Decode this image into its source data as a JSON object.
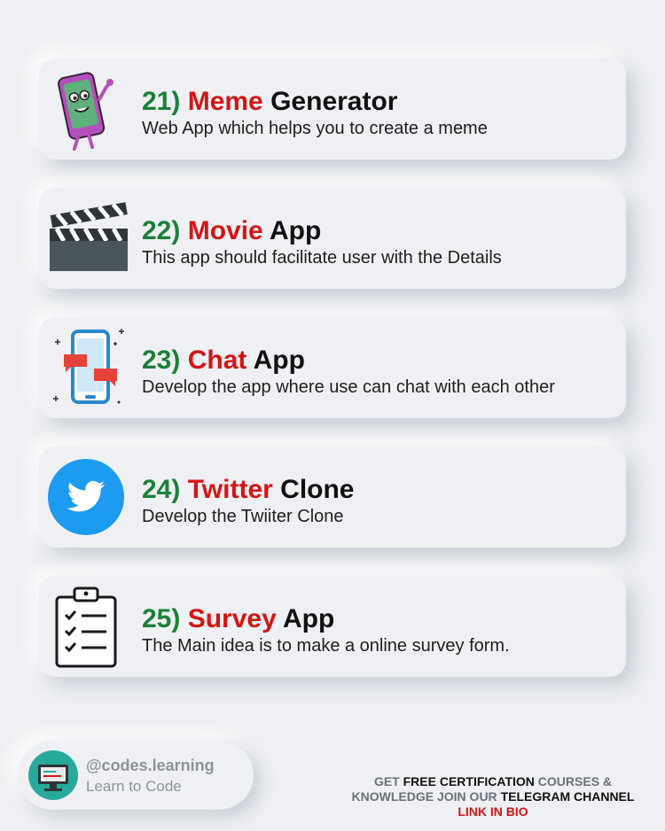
{
  "cards": [
    {
      "num": "21)",
      "highlight": "Meme",
      "rest": "Generator",
      "desc": "Web App which helps you to create a meme",
      "icon": "phone-character-icon"
    },
    {
      "num": "22)",
      "highlight": "Movie",
      "rest": "App",
      "desc": "This app should facilitate user with the Details",
      "icon": "clapperboard-icon"
    },
    {
      "num": "23)",
      "highlight": "Chat",
      "rest": "App",
      "desc": "Develop the app where use can chat with each other",
      "icon": "mobile-chat-icon"
    },
    {
      "num": "24)",
      "highlight": "Twitter",
      "rest": "Clone",
      "desc": "Develop the Twiiter Clone",
      "icon": "twitter-bird-icon"
    },
    {
      "num": "25)",
      "highlight": "Survey",
      "rest": "App",
      "desc": "The Main idea is to make a online survey form.",
      "icon": "clipboard-checklist-icon"
    }
  ],
  "profile": {
    "handle": "@codes.learning",
    "tagline": "Learn to Code",
    "avatar_icon": "computer-avatar-icon"
  },
  "promo": {
    "p1": "GET ",
    "p2": "FREE CERTIFICATION",
    "p3": " COURSES & KNOWLEDGE JOIN OUR ",
    "p4": "TELEGRAM CHANNEL",
    "p5": "LINK IN BIO"
  },
  "colors": {
    "number": "#1b7f3a",
    "highlight": "#d41515",
    "twitter": "#1d9bf0",
    "background": "#eef0f3"
  }
}
